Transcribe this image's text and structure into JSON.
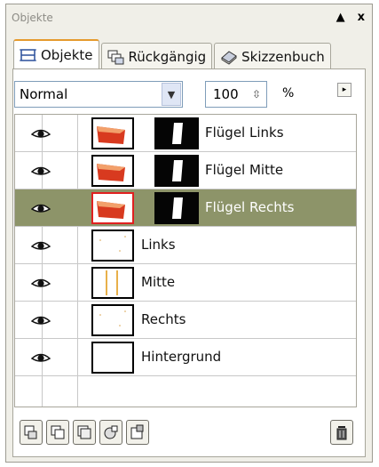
{
  "panel": {
    "title": "Objekte",
    "minimize_glyph": "▲",
    "close_glyph": "x"
  },
  "tabs": [
    {
      "label": "Objekte",
      "icon": "layers-icon",
      "active": true
    },
    {
      "label": "Rückgängig",
      "icon": "history-icon",
      "active": false
    },
    {
      "label": "Skizzenbuch",
      "icon": "sketchbook-icon",
      "active": false
    }
  ],
  "controls": {
    "blend_mode": "Normal",
    "opacity": "100",
    "opacity_unit": "%",
    "spin_glyph": "⇳",
    "dropdown_glyph": "▼",
    "menu_glyph": "▸"
  },
  "objects": [
    {
      "label": "Flügel Links",
      "visible": true,
      "selected": false,
      "has_mask": true,
      "thumb": "red-wing"
    },
    {
      "label": "Flügel Mitte",
      "visible": true,
      "selected": false,
      "has_mask": true,
      "thumb": "red-wing"
    },
    {
      "label": "Flügel Rechts",
      "visible": true,
      "selected": true,
      "has_mask": true,
      "thumb": "red-wing"
    },
    {
      "label": "Links",
      "visible": true,
      "selected": false,
      "has_mask": false,
      "thumb": "dots"
    },
    {
      "label": "Mitte",
      "visible": true,
      "selected": false,
      "has_mask": false,
      "thumb": "bars"
    },
    {
      "label": "Rechts",
      "visible": true,
      "selected": false,
      "has_mask": false,
      "thumb": "dots"
    },
    {
      "label": "Hintergrund",
      "visible": true,
      "selected": false,
      "has_mask": false,
      "thumb": "blank"
    }
  ],
  "colors": {
    "selected_row": "#8d9469",
    "active_tab_accent": "#e59a2d",
    "thumb_red": "#d83a1f"
  },
  "bottom_buttons": [
    {
      "icon": "object-properties-icon"
    },
    {
      "icon": "new-object-icon"
    },
    {
      "icon": "combine-icon"
    },
    {
      "icon": "group-icon"
    },
    {
      "icon": "new-mask-icon"
    },
    {
      "icon": "trash-icon"
    }
  ]
}
